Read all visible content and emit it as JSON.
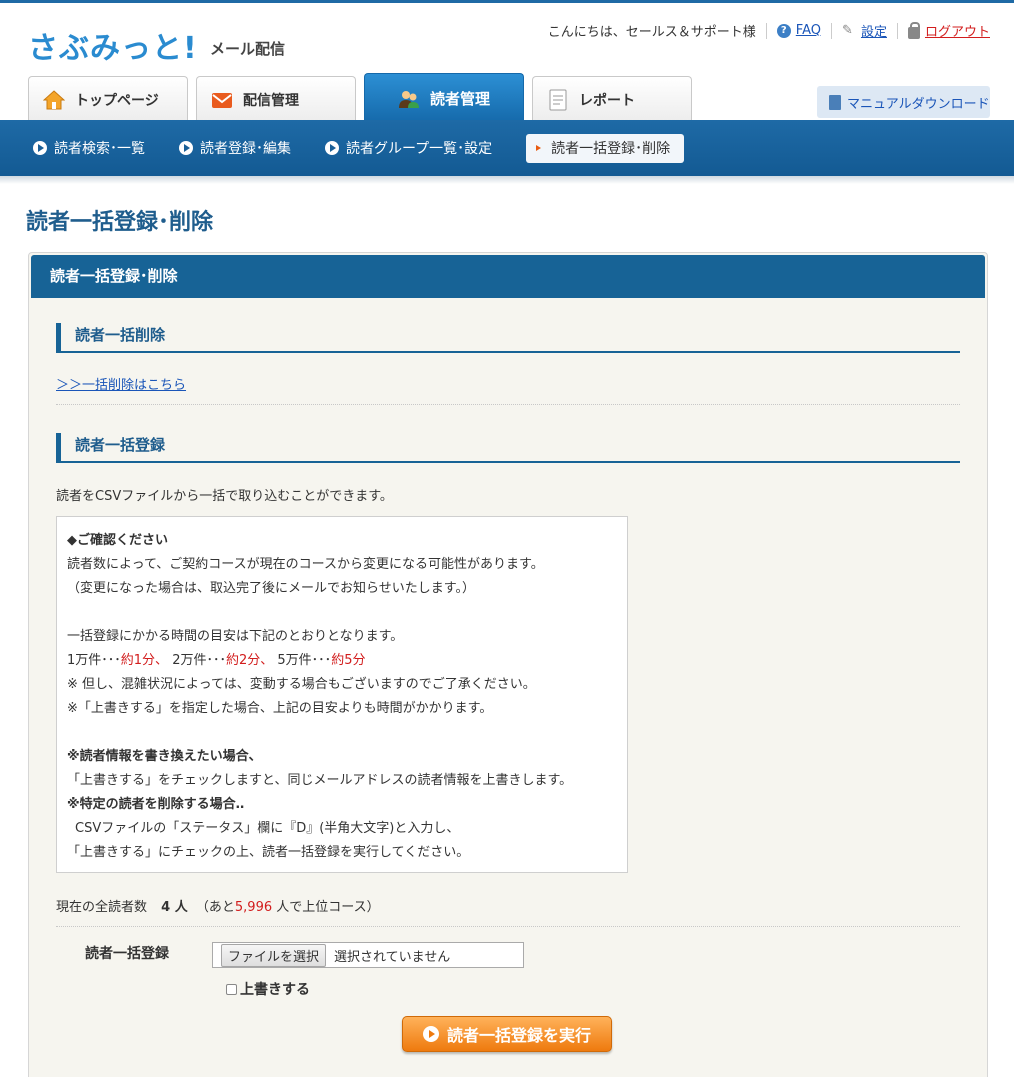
{
  "header": {
    "logo_main": "さぶみっと!",
    "logo_sub": "メール配信",
    "greeting": "こんにちは、セールス＆サポート様",
    "faq": "FAQ",
    "settings": "設定",
    "logout": "ログアウト",
    "manual": "マニュアルダウンロード"
  },
  "tabs": [
    {
      "label": "トップページ",
      "icon": "home-icon"
    },
    {
      "label": "配信管理",
      "icon": "mail-icon"
    },
    {
      "label": "読者管理",
      "icon": "users-icon"
    },
    {
      "label": "レポート",
      "icon": "report-icon"
    }
  ],
  "subnav": [
    {
      "label": "読者検索･一覧"
    },
    {
      "label": "読者登録･編集"
    },
    {
      "label": "読者グループ一覧･設定"
    },
    {
      "label": "読者一括登録･削除"
    }
  ],
  "page": {
    "title": "読者一括登録･削除",
    "panel_title": "読者一括登録･削除"
  },
  "delete_section": {
    "title": "読者一括削除",
    "link": "＞＞一括削除はこちら"
  },
  "register_section": {
    "title": "読者一括登録",
    "description": "読者をCSVファイルから一括で取り込むことができます。"
  },
  "notice": {
    "heading": "◆ご確認ください",
    "line1": "読者数によって、ご契約コースが現在のコースから変更になる可能性があります。",
    "line2": "（変更になった場合は、取込完了後にメールでお知らせいたします。）",
    "line3": "一括登録にかかる時間の目安は下記のとおりとなります。",
    "time_a_label": "1万件･･･",
    "time_a_value": "約1分、",
    "time_b_label": "2万件･･･",
    "time_b_value": "約2分、",
    "time_c_label": "5万件･･･",
    "time_c_value": "約5分",
    "line5": "※ 但し、混雑状況によっては、変動する場合もございますのでご了承ください。",
    "line6": "※「上書きする」を指定した場合、上記の目安よりも時間がかかります。",
    "bold1": "※読者情報を書き換えたい場合、",
    "line7": "「上書きする」をチェックしますと、同じメールアドレスの読者情報を上書きします。",
    "bold2": "※特定の読者を削除する場合‥",
    "line8": "CSVファイルの「ステータス」欄に『D』(半角大文字)と入力し、",
    "line9": "「上書きする」にチェックの上、読者一括登録を実行してください。"
  },
  "count": {
    "prefix": "現在の全読者数",
    "value": "4 人",
    "middle": "（あと",
    "remaining": "5,996",
    "suffix": "人で上位コース）"
  },
  "upload": {
    "label": "読者一括登録",
    "file_button": "ファイルを選択",
    "file_status": "選択されていません",
    "overwrite_label": "上書きする",
    "execute_button": "読者一括登録を実行"
  }
}
